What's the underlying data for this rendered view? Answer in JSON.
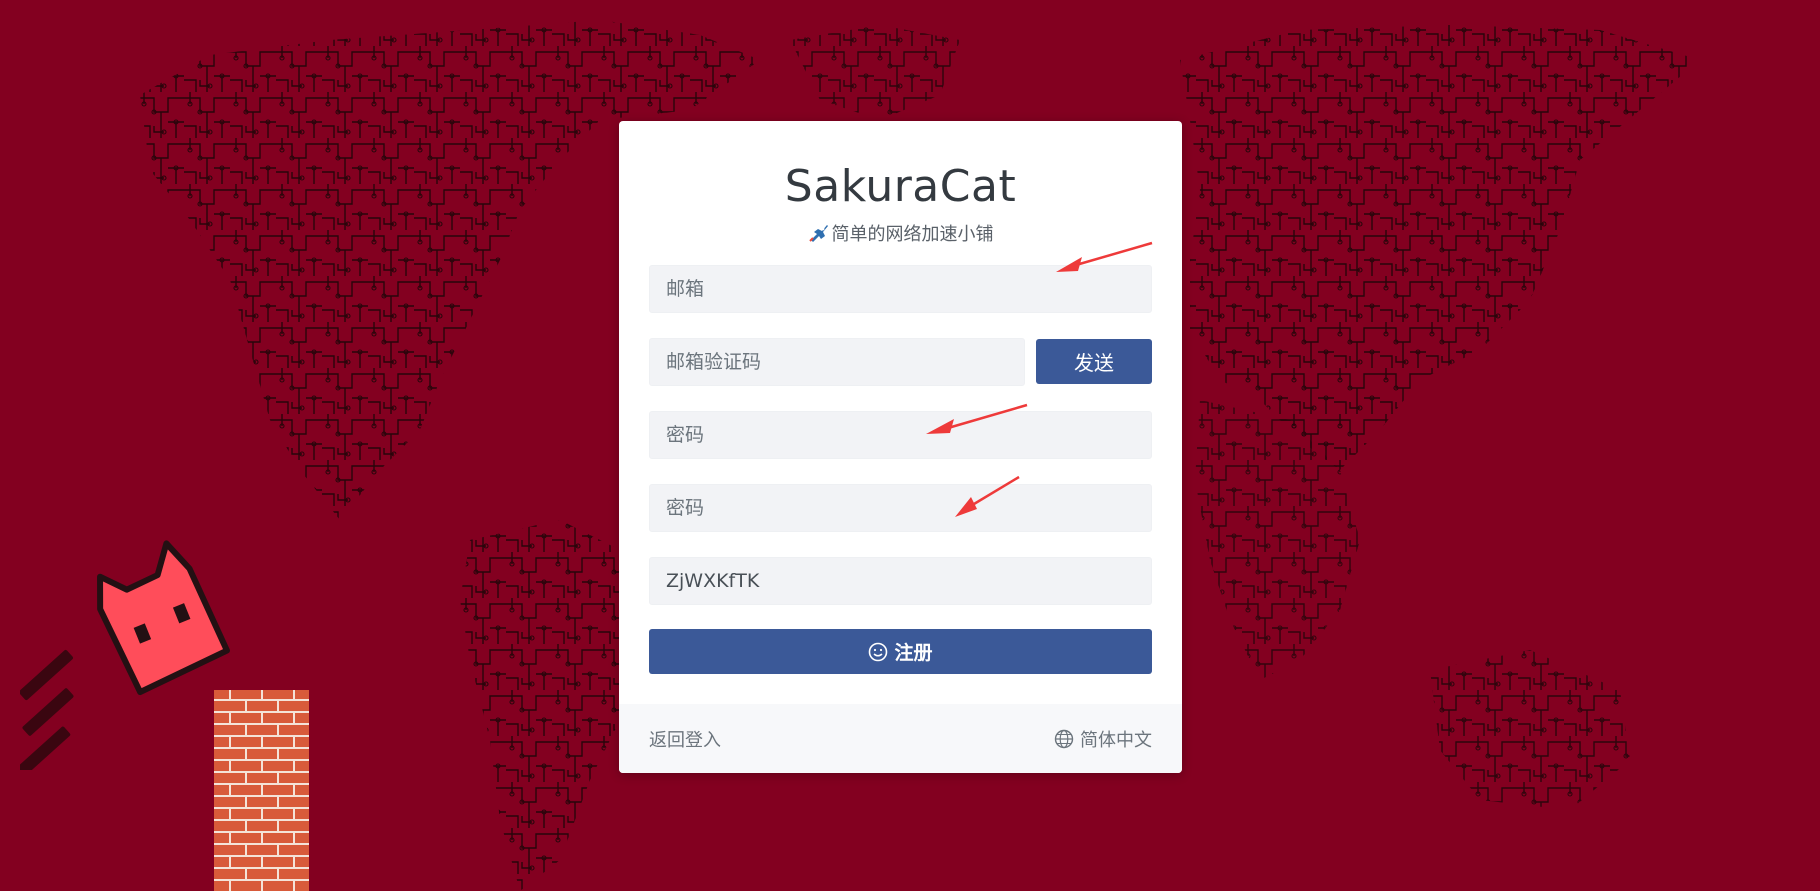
{
  "brand": {
    "title": "SakuraCat",
    "subtitle": "简单的网络加速小铺"
  },
  "form": {
    "email_placeholder": "邮箱",
    "email_code_placeholder": "邮箱验证码",
    "send_label": "发送",
    "password_placeholder": "密码",
    "password_confirm_placeholder": "密码",
    "invite_code_value": "ZjWXKfTK",
    "submit_label": "注册"
  },
  "footer": {
    "back_to_login": "返回登入",
    "language": "简体中文"
  },
  "colors": {
    "background": "#830020",
    "primary": "#3b5998",
    "cat": "#ff4d5a",
    "arrow": "#ee3a3a"
  },
  "icons": {
    "rocket": "rocket-icon",
    "smile": "smile-icon",
    "globe": "globe-icon"
  }
}
